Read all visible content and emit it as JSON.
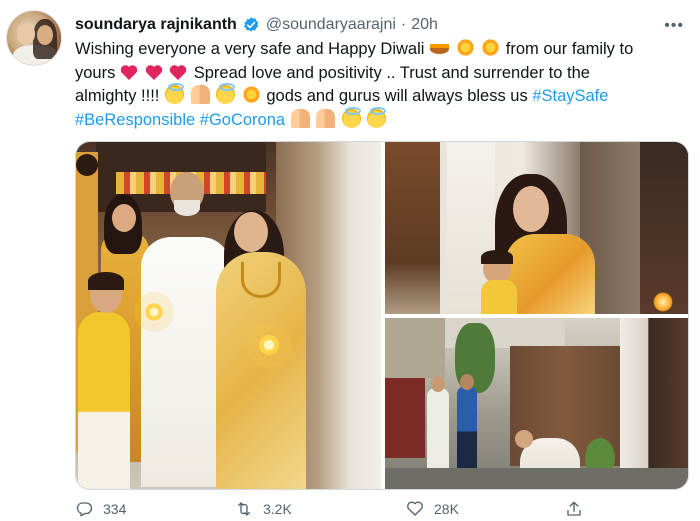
{
  "tweet": {
    "author": {
      "display_name": "soundarya rajnikanth",
      "handle": "@soundaryaarajni",
      "separator": "·",
      "time": "20h",
      "verified": true
    },
    "more_label": "•••",
    "text_segments": {
      "s1": "Wishing everyone a very safe and Happy Diwali",
      "s2": " from our family to",
      "s3": "yours",
      "s4": " Spread love and positivity .. Trust and surrender to the",
      "s5": "almighty !!!!",
      "s6": " gods and gurus will always bless us ",
      "tag1": "#StaySafe",
      "tag2": "#BeResponsible",
      "tag3": "#GoCorona"
    },
    "emoji": [
      "diya-lamp",
      "sparkles",
      "sparkle-star",
      "red-heart",
      "smiling-face-with-halo",
      "folded-hands"
    ],
    "media": {
      "photo_count": 3
    },
    "actions": {
      "replies": "334",
      "retweets": "3.2K",
      "likes": "28K"
    }
  },
  "colors": {
    "link": "#1d9bf0",
    "muted": "#536471",
    "text": "#0f1419",
    "verified": "#1d9bf0",
    "heart": "#e0245e"
  }
}
